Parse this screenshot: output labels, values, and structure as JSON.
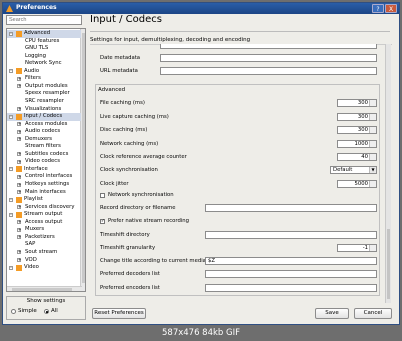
{
  "window": {
    "title": "Preferences",
    "help_label": "?",
    "close_label": "X"
  },
  "search": {
    "placeholder": "Search"
  },
  "tree": {
    "items": [
      {
        "label": "Advanced",
        "level": 1,
        "expander": "-",
        "icon": true,
        "selected": true
      },
      {
        "label": "CPU features",
        "level": 2
      },
      {
        "label": "GNU TLS",
        "level": 2
      },
      {
        "label": "Logging",
        "level": 2
      },
      {
        "label": "Network Sync",
        "level": 2
      },
      {
        "label": "Audio",
        "level": 1,
        "expander": "-",
        "icon": true
      },
      {
        "label": "Filters",
        "level": 2,
        "expander": "+"
      },
      {
        "label": "Output modules",
        "level": 2,
        "expander": "+"
      },
      {
        "label": "Speex resampler",
        "level": 2
      },
      {
        "label": "SRC resampler",
        "level": 2
      },
      {
        "label": "Visualizations",
        "level": 2,
        "expander": "+"
      },
      {
        "label": "Input / Codecs",
        "level": 1,
        "expander": "-",
        "icon": true,
        "selected": true
      },
      {
        "label": "Access modules",
        "level": 2,
        "expander": "+"
      },
      {
        "label": "Audio codecs",
        "level": 2,
        "expander": "+"
      },
      {
        "label": "Demuxers",
        "level": 2,
        "expander": "+"
      },
      {
        "label": "Stream filters",
        "level": 2
      },
      {
        "label": "Subtitles codecs",
        "level": 2,
        "expander": "+"
      },
      {
        "label": "Video codecs",
        "level": 2,
        "expander": "+"
      },
      {
        "label": "Interface",
        "level": 1,
        "expander": "-",
        "icon": true
      },
      {
        "label": "Control interfaces",
        "level": 2,
        "expander": "+"
      },
      {
        "label": "Hotkeys settings",
        "level": 2,
        "expander": "+"
      },
      {
        "label": "Main interfaces",
        "level": 2,
        "expander": "+"
      },
      {
        "label": "Playlist",
        "level": 1,
        "expander": "-",
        "icon": true
      },
      {
        "label": "Services discovery",
        "level": 2,
        "expander": "+"
      },
      {
        "label": "Stream output",
        "level": 1,
        "expander": "-",
        "icon": true
      },
      {
        "label": "Access output",
        "level": 2,
        "expander": "+"
      },
      {
        "label": "Muxers",
        "level": 2,
        "expander": "+"
      },
      {
        "label": "Packetizers",
        "level": 2,
        "expander": "+"
      },
      {
        "label": "SAP",
        "level": 2
      },
      {
        "label": "Sout stream",
        "level": 2,
        "expander": "+"
      },
      {
        "label": "VOD",
        "level": 2,
        "expander": "+"
      },
      {
        "label": "Video",
        "level": 1,
        "expander": "-",
        "icon": true
      }
    ]
  },
  "show_settings": {
    "label": "Show settings",
    "simple_label": "Simple",
    "all_label": "All",
    "selected": "All"
  },
  "panel": {
    "title": "Input / Codecs",
    "subtitle": "Settings for input, demultiplexing, decoding and encoding",
    "metadata_rows": [
      {
        "label": "Date metadata",
        "value": ""
      },
      {
        "label": "URL metadata",
        "value": ""
      }
    ],
    "advanced": {
      "title": "Advanced",
      "file_caching_label": "File caching (ms)",
      "file_caching_value": "300",
      "live_caching_label": "Live capture caching (ms)",
      "live_caching_value": "300",
      "disc_caching_label": "Disc caching (ms)",
      "disc_caching_value": "300",
      "network_caching_label": "Network caching (ms)",
      "network_caching_value": "1000",
      "clock_avg_label": "Clock reference average counter",
      "clock_avg_value": "40",
      "clock_sync_label": "Clock synchronisation",
      "clock_sync_value": "Default",
      "clock_jitter_label": "Clock jitter",
      "clock_jitter_value": "5000",
      "network_sync_label": "Network synchronisation",
      "network_sync_checked": false,
      "record_dir_label": "Record directory or filename",
      "record_dir_value": "",
      "prefer_native_label": "Prefer native stream recording",
      "prefer_native_checked": true,
      "timeshift_dir_label": "Timeshift directory",
      "timeshift_dir_value": "",
      "timeshift_gran_label": "Timeshift granularity",
      "timeshift_gran_value": "-1",
      "change_title_label": "Change title according to current media",
      "change_title_value": "$Z",
      "pref_decoders_label": "Preferred decoders list",
      "pref_decoders_value": "",
      "pref_encoders_label": "Preferred encoders list",
      "pref_encoders_value": ""
    }
  },
  "buttons": {
    "reset": "Reset Preferences",
    "save": "Save",
    "cancel": "Cancel"
  },
  "caption": "587x476  84kb  GIF"
}
